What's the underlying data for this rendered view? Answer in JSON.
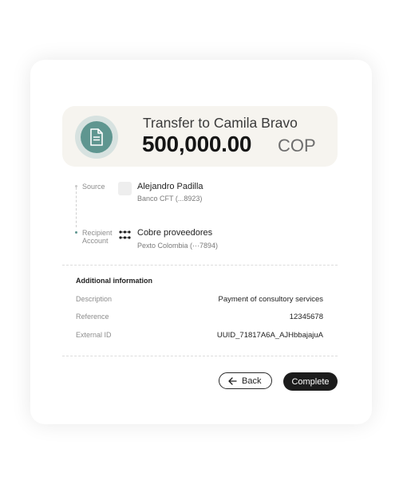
{
  "summary": {
    "title": "Transfer to Camila Bravo",
    "amount": "500,000.00",
    "currency": "COP",
    "icon": "document-icon"
  },
  "source": {
    "label": "Source",
    "name": "Alejandro Padilla",
    "detail": "Banco CFT (...8923)"
  },
  "recipient": {
    "label_line1": "Recipient",
    "label_line2": "Account",
    "name": "Cobre proveedores",
    "detail": "Pexto Colombia (···7894)"
  },
  "additional": {
    "title": "Additional information",
    "rows": [
      {
        "label": "Description",
        "value": "Payment of consultory services"
      },
      {
        "label": "Reference",
        "value": "12345678"
      },
      {
        "label": "External ID",
        "value": "UUID_71817A6A_AJHbbajajuA"
      }
    ]
  },
  "actions": {
    "back_label": "Back",
    "complete_label": "Complete"
  },
  "colors": {
    "accent": "#5f9690",
    "summary_bg": "#f6f4ef",
    "button_dark": "#1c1c1c"
  }
}
